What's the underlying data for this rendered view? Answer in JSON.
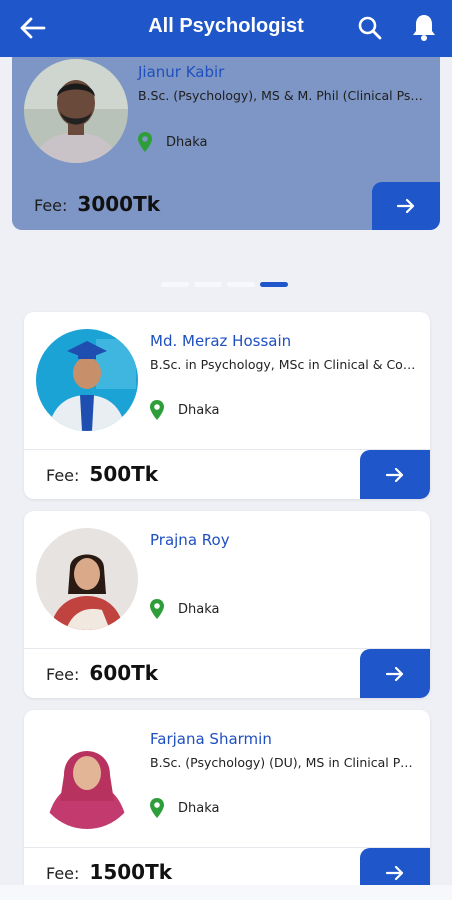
{
  "header": {
    "title": "All Psychologist",
    "back_icon": "arrow-left-icon",
    "search_icon": "search-icon",
    "notification_icon": "bell-icon"
  },
  "colors": {
    "primary": "#1f56c9",
    "featured_bg": "#7e96c5",
    "name_text": "#1f4fbf",
    "location_pin": "#2e9e3a"
  },
  "featured": {
    "name": "Jianur Kabir",
    "degree": "B.Sc. (Psychology), MS & M. Phil (Clinical Psychology)",
    "location": "Dhaka",
    "fee_label": "Fee:",
    "fee_amount": "3000Tk"
  },
  "carousel": {
    "pages": 4,
    "active_index": 3
  },
  "psychologists": [
    {
      "name": "Md. Meraz Hossain",
      "degree": "B.Sc. in Psychology, MSc in Clinical & Counselling Psychology",
      "location": "Dhaka",
      "fee_label": "Fee:",
      "fee_amount": "500Tk"
    },
    {
      "name": "Prajna Roy",
      "degree": "",
      "location": "Dhaka",
      "fee_label": "Fee:",
      "fee_amount": "600Tk"
    },
    {
      "name": "Farjana Sharmin",
      "degree": "B.Sc. (Psychology) (DU), MS in Clinical Psychology",
      "location": "Dhaka",
      "fee_label": "Fee:",
      "fee_amount": "1500Tk"
    }
  ]
}
